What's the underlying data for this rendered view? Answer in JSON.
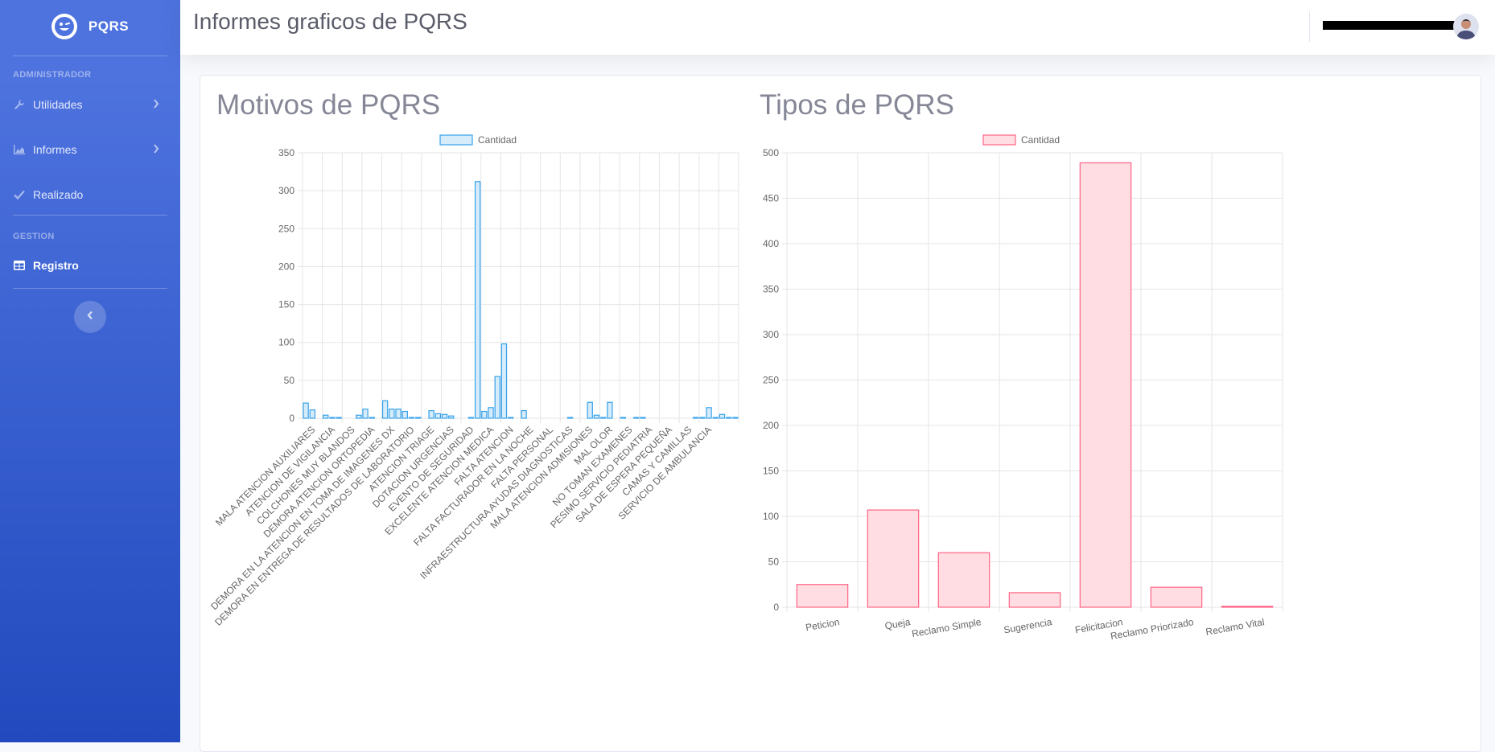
{
  "sidebar": {
    "brand": "PQRS",
    "heading_admin": "ADMINISTRADOR",
    "heading_gestion": "GESTION",
    "items": [
      {
        "label": "Utilidades",
        "icon": "wrench-icon"
      },
      {
        "label": "Informes",
        "icon": "chart-area-icon"
      },
      {
        "label": "Realizado",
        "icon": "check-icon"
      },
      {
        "label": "Registro",
        "icon": "table-icon"
      }
    ]
  },
  "topbar": {
    "page_title": "Informes graficos de PQRS"
  },
  "colors": {
    "sidebar_start": "#4e73df",
    "sidebar_end": "#224abe",
    "bar_blue_fill": "#d6ecfa",
    "bar_blue_border": "#36a2eb",
    "bar_pink_fill": "#ffdde3",
    "bar_pink_border": "#ff6384"
  },
  "chart_data": [
    {
      "type": "bar",
      "title": "Motivos de PQRS",
      "legend": "Cantidad",
      "ylim": [
        0,
        350
      ],
      "yticks": [
        0,
        50,
        100,
        150,
        200,
        250,
        300,
        350
      ],
      "category_labels": [
        "MALA ATENCION AUXILIARES",
        "ATENCION DE VIGILANCIA",
        "COLCHONES MUY BLANDOS",
        "DEMORA ATENCION ORTOPEDIA",
        "DEMORA EN LA ATENCION EN TOMA DE IMAGENES DX",
        "DEMORA EN ENTREGA DE RESULTADOS DE LABORATORIO",
        "ATENCION TRIAGE",
        "DOTACION URGENCIAS",
        "EVENTO DE SEGURIDAD",
        "EXCELENTE ATENCION MEDICA",
        "FALTA ATENCION",
        "FALTA FACTURADOR EN LA NOCHE",
        "FALTA PERSONAL",
        "INFRAESTRUCTURA AYUDAS DIAGNOSTICAS",
        "MALA ATENCION ADMISIONES",
        "MAL OLOR",
        "NO TOMAN EXAMENES",
        "PESIMO SERVICIO PEDIATRIA",
        "SALA DE ESPERA PEQUEÑA",
        "CAMAS Y CAMILLAS",
        "SERVICIO DE AMBULANCIA"
      ],
      "values": [
        20,
        11,
        0,
        4,
        1,
        1,
        0,
        0,
        4,
        12,
        1,
        0,
        23,
        12,
        12,
        9,
        1,
        1,
        0,
        10,
        6,
        5,
        3,
        0,
        0,
        1,
        312,
        9,
        14,
        55,
        98,
        1,
        0,
        10,
        0,
        0,
        0,
        0,
        0,
        0,
        1,
        0,
        0,
        21,
        4,
        1,
        21,
        0,
        1,
        0,
        1,
        1,
        0,
        0,
        0,
        0,
        0,
        0,
        0,
        1,
        1,
        14,
        1,
        5,
        1,
        1
      ]
    },
    {
      "type": "bar",
      "title": "Tipos de PQRS",
      "legend": "Cantidad",
      "ylim": [
        0,
        500
      ],
      "yticks": [
        0,
        50,
        100,
        150,
        200,
        250,
        300,
        350,
        400,
        450,
        500
      ],
      "categories": [
        "Peticion",
        "Queja",
        "Reclamo Simple",
        "Sugerencia",
        "Felicitacion",
        "Reclamo Priorizado",
        "Reclamo Vital"
      ],
      "values": [
        25,
        107,
        60,
        16,
        489,
        22,
        1
      ]
    }
  ]
}
